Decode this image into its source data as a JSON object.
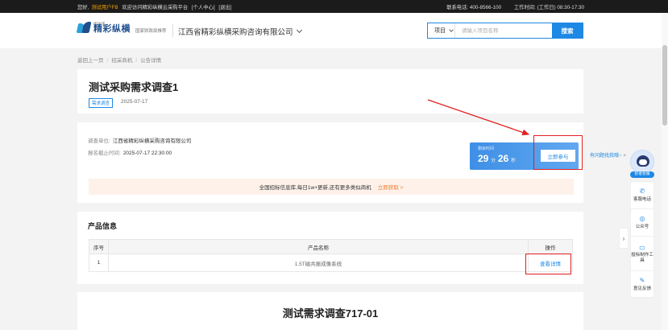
{
  "topbar": {
    "greeting": "您好,",
    "user": "测试用户FB",
    "welcome": "欢迎访问精彩纵横云采购平台",
    "personal_center": "[个人中心]",
    "logout": "[退出]",
    "phone": "联系电话: 400-8566-100",
    "hours": "工作时间: (工作日) 08:30-17:30"
  },
  "header": {
    "logo_small": "精彩纵横",
    "logo_big": "精彩纵横",
    "slogan": "国家财政部推荐",
    "company": "江西省精彩纵横采购咨询有限公司",
    "search_type": "项目",
    "search_placeholder": "请输入项目名称",
    "search_button": "搜索"
  },
  "breadcrumb": {
    "back": "返回上一页",
    "list": "招采商机",
    "current": "公告详情",
    "sep": "/"
  },
  "notice": {
    "title": "测试采购需求调查1",
    "tag": "需求调查",
    "date": "2025-07-17",
    "unit_label": "调查单位:",
    "unit_value": "江西省精彩纵横采购咨询有限公司",
    "deadline_label": "报名截止时间:",
    "deadline_value": "2025-07-17 22:30:00"
  },
  "countdown": {
    "label": "剩余时间",
    "minutes": "29",
    "minutes_unit": "分",
    "seconds": "26",
    "seconds_unit": "秒",
    "join_button": "立即参与"
  },
  "promo": {
    "text": "全国招标信息库,每日1w+更新,还有更多类似商机",
    "link": "立即获取 >"
  },
  "products": {
    "section_title": "产品信息",
    "headers": [
      "序号",
      "产品名称",
      "操作"
    ],
    "rows": [
      {
        "index": "1",
        "name": "1.5T磁共振成像系统",
        "action": "查看详情"
      }
    ]
  },
  "document": {
    "title": "测试需求调查717-01"
  },
  "side": {
    "help_text": "有问题找我哦~",
    "close": "×",
    "assistant_label": "智者客服",
    "items": [
      {
        "label": "客服电话",
        "icon": "phone-icon"
      },
      {
        "label": "公众号",
        "icon": "wechat-icon"
      },
      {
        "label": "投标制作工具",
        "icon": "monitor-icon"
      },
      {
        "label": "意见反馈",
        "icon": "feedback-icon"
      }
    ],
    "collapse": "›"
  },
  "colors": {
    "accent": "#1e88e5",
    "annotation": "#e02020",
    "promo_link": "#f07a2a"
  }
}
